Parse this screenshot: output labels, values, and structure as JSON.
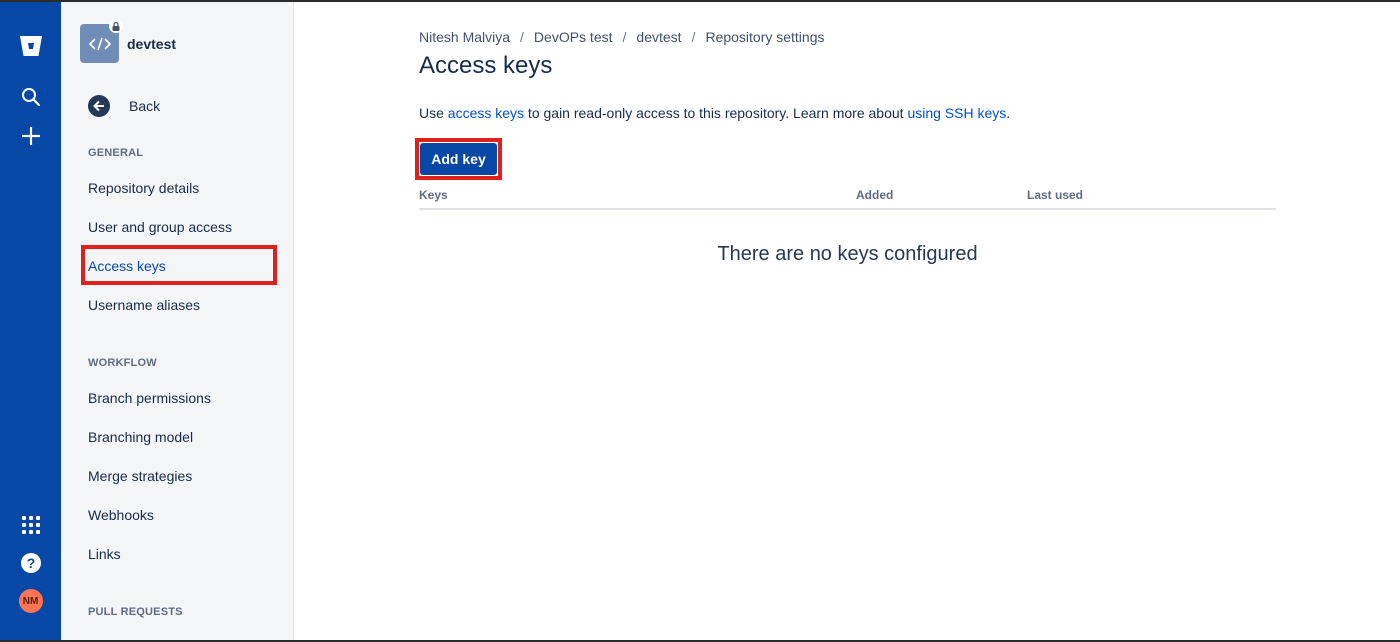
{
  "global_nav": {
    "logo": "bitbucket-logo-icon",
    "search": "search-icon",
    "create": "plus-icon",
    "apps": "app-switcher-icon",
    "help": "help-icon",
    "avatar_initials": "NM",
    "colors": {
      "background": "#0747a6",
      "avatar": "#ff7452"
    }
  },
  "sidebar": {
    "repo_name": "devtest",
    "back_label": "Back",
    "sections": {
      "general": "GENERAL",
      "workflow": "WORKFLOW",
      "pull_requests": "PULL REQUESTS"
    },
    "general_items": [
      {
        "label": "Repository details"
      },
      {
        "label": "User and group access"
      },
      {
        "label": "Access keys",
        "active": true
      },
      {
        "label": "Username aliases"
      }
    ],
    "workflow_items": [
      {
        "label": "Branch permissions"
      },
      {
        "label": "Branching model"
      },
      {
        "label": "Merge strategies"
      },
      {
        "label": "Webhooks"
      },
      {
        "label": "Links"
      }
    ]
  },
  "main": {
    "breadcrumbs": [
      "Nitesh Malviya",
      "DevOPs test",
      "devtest",
      "Repository settings"
    ],
    "breadcrumb_separator": "/",
    "title": "Access keys",
    "description": {
      "prefix": "Use ",
      "link1": "access keys",
      "middle": " to gain read-only access to this repository. Learn more about ",
      "link2": "using SSH keys",
      "suffix": "."
    },
    "add_key_label": "Add key",
    "table": {
      "columns": [
        "Keys",
        "Added",
        "Last used"
      ]
    },
    "empty_message": "There are no keys configured"
  },
  "annotations": {
    "highlight_color": "#e0201c"
  }
}
